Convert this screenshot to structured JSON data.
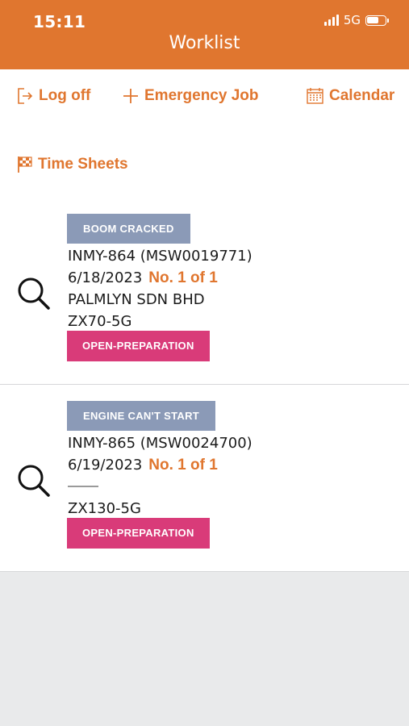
{
  "status_bar": {
    "time": "15:11",
    "network": "5G"
  },
  "header": {
    "title": "Worklist"
  },
  "toolbar": {
    "logoff": "Log off",
    "emergency": "Emergency Job",
    "calendar": "Calendar",
    "timesheets": "Time Sheets"
  },
  "jobs": [
    {
      "tag": "BOOM CRACKED",
      "id": "INMY-864 (MSW0019771)",
      "date": "6/18/2023",
      "no": "No. 1 of 1",
      "customer": "PALMLYN SDN BHD",
      "model": "ZX70-5G",
      "status": "OPEN-PREPARATION"
    },
    {
      "tag": "ENGINE CAN'T START",
      "id": "INMY-865 (MSW0024700)",
      "date": "6/19/2023",
      "no": "No. 1 of 1",
      "customer": "",
      "model": "ZX130-5G",
      "status": "OPEN-PREPARATION"
    }
  ],
  "colors": {
    "accent": "#e0762f",
    "tag": "#8b9ab7",
    "status": "#d93b79"
  }
}
